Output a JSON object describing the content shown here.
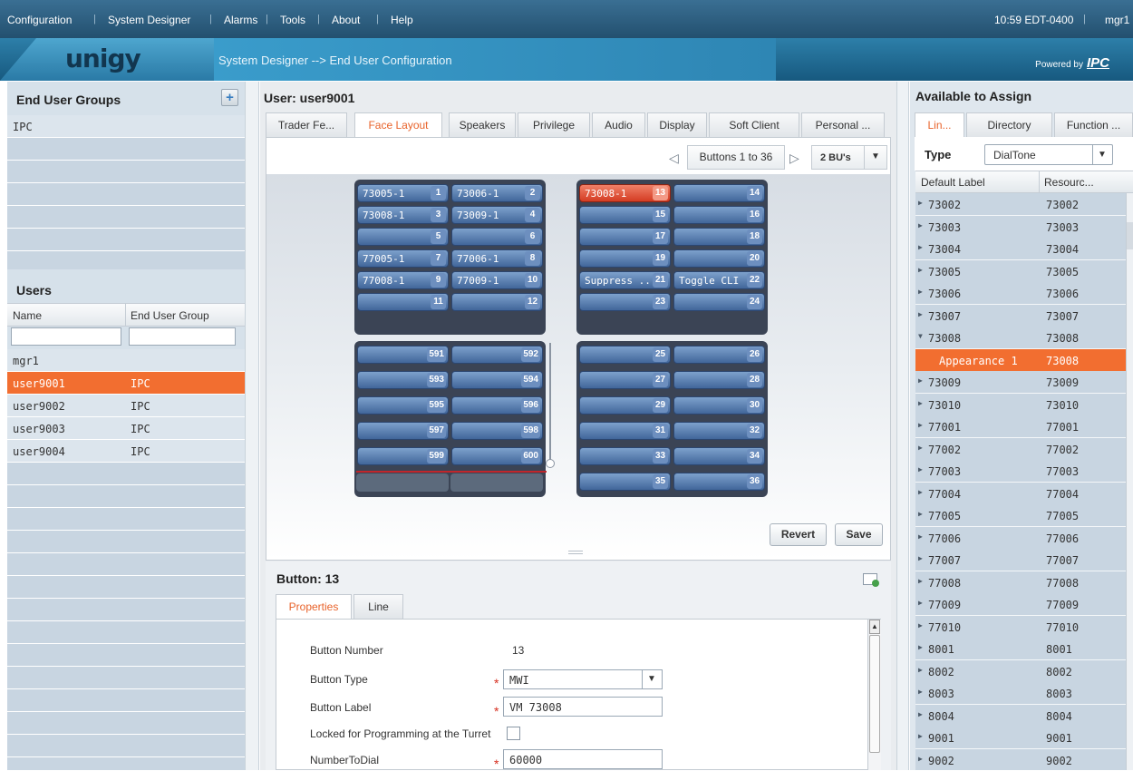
{
  "menu": {
    "items": [
      "Configuration",
      "System Designer",
      "Alarms",
      "Tools",
      "About",
      "Help"
    ],
    "clock": "10:59 EDT-0400",
    "user": "mgr1"
  },
  "banner": {
    "logo": "unigy",
    "breadcrumb": "System Designer --> End User Configuration",
    "powered_by": "Powered by",
    "brand": "IPC"
  },
  "groups": {
    "title": "End User Groups",
    "items": [
      "IPC"
    ]
  },
  "users": {
    "title": "Users",
    "col_name": "Name",
    "col_group": "End User Group",
    "rows": [
      {
        "name": "mgr1",
        "group": ""
      },
      {
        "name": "user9001",
        "group": "IPC"
      },
      {
        "name": "user9002",
        "group": "IPC"
      },
      {
        "name": "user9003",
        "group": "IPC"
      },
      {
        "name": "user9004",
        "group": "IPC"
      }
    ]
  },
  "center": {
    "title": "User: user9001",
    "tabs": [
      "Trader Fe...",
      "Face Layout",
      "Speakers",
      "Privilege",
      "Audio",
      "Display",
      "Soft Client",
      "Personal ..."
    ],
    "pager": "Buttons 1 to 36",
    "bu_select": "2 BU's",
    "revert": "Revert",
    "save": "Save"
  },
  "layout": {
    "blockA": [
      [
        "73005-1",
        "1"
      ],
      [
        "73006-1",
        "2"
      ],
      [
        "73008-1",
        "3"
      ],
      [
        "73009-1",
        "4"
      ],
      [
        "",
        "5"
      ],
      [
        "",
        "6"
      ],
      [
        "77005-1",
        "7"
      ],
      [
        "77006-1",
        "8"
      ],
      [
        "77008-1",
        "9"
      ],
      [
        "77009-1",
        "10"
      ],
      [
        "",
        "11"
      ],
      [
        "",
        "12"
      ]
    ],
    "blockB": [
      [
        "73008-1",
        "13"
      ],
      [
        "",
        "14"
      ],
      [
        "",
        "15"
      ],
      [
        "",
        "16"
      ],
      [
        "",
        "17"
      ],
      [
        "",
        "18"
      ],
      [
        "",
        "19"
      ],
      [
        "",
        "20"
      ],
      [
        "Suppress ...",
        "21"
      ],
      [
        "Toggle CLI",
        "22"
      ],
      [
        "",
        "23"
      ],
      [
        "",
        "24"
      ]
    ],
    "blockC": [
      [
        "",
        "591"
      ],
      [
        "",
        "592"
      ],
      [
        "",
        "593"
      ],
      [
        "",
        "594"
      ],
      [
        "",
        "595"
      ],
      [
        "",
        "596"
      ],
      [
        "",
        "597"
      ],
      [
        "",
        "598"
      ],
      [
        "",
        "599"
      ],
      [
        "",
        "600"
      ]
    ],
    "blockD": [
      [
        "",
        "25"
      ],
      [
        "",
        "26"
      ],
      [
        "",
        "27"
      ],
      [
        "",
        "28"
      ],
      [
        "",
        "29"
      ],
      [
        "",
        "30"
      ],
      [
        "",
        "31"
      ],
      [
        "",
        "32"
      ],
      [
        "",
        "33"
      ],
      [
        "",
        "34"
      ],
      [
        "",
        "35"
      ],
      [
        "",
        "36"
      ]
    ]
  },
  "button_panel": {
    "title": "Button: 13",
    "tabs": [
      "Properties",
      "Line"
    ],
    "fields": [
      {
        "label": "Button Number",
        "value": "13",
        "kind": "text"
      },
      {
        "label": "Button Type",
        "value": "MWI",
        "kind": "select"
      },
      {
        "label": "Button Label",
        "value": "VM 73008",
        "kind": "input"
      },
      {
        "label": "Locked for Programming at the Turret",
        "value": "",
        "kind": "checkbox"
      },
      {
        "label": "NumberToDial",
        "value": "60000",
        "kind": "input"
      }
    ]
  },
  "available": {
    "title": "Available to Assign",
    "tabs": [
      "Lin...",
      "Directory",
      "Function ..."
    ],
    "type_label": "Type",
    "type_value": "DialTone",
    "col_label": "Default Label",
    "col_resource": "Resourc...",
    "rows": [
      [
        "73002",
        "73002"
      ],
      [
        "73003",
        "73003"
      ],
      [
        "73004",
        "73004"
      ],
      [
        "73005",
        "73005"
      ],
      [
        "73006",
        "73006"
      ],
      [
        "73007",
        "73007"
      ],
      [
        "73008",
        "73008"
      ],
      [
        "Appearance 1",
        "73008"
      ],
      [
        "73009",
        "73009"
      ],
      [
        "73010",
        "73010"
      ],
      [
        "77001",
        "77001"
      ],
      [
        "77002",
        "77002"
      ],
      [
        "77003",
        "77003"
      ],
      [
        "77004",
        "77004"
      ],
      [
        "77005",
        "77005"
      ],
      [
        "77006",
        "77006"
      ],
      [
        "77007",
        "77007"
      ],
      [
        "77008",
        "77008"
      ],
      [
        "77009",
        "77009"
      ],
      [
        "77010",
        "77010"
      ],
      [
        "8001",
        "8001"
      ],
      [
        "8002",
        "8002"
      ],
      [
        "8003",
        "8003"
      ],
      [
        "8004",
        "8004"
      ],
      [
        "9001",
        "9001"
      ],
      [
        "9002",
        "9002"
      ]
    ]
  },
  "colors": {
    "accent": "#f26e30",
    "selected_button": "#d9452a",
    "button_blue": "#5577aa",
    "header_dark": "#23506f"
  }
}
